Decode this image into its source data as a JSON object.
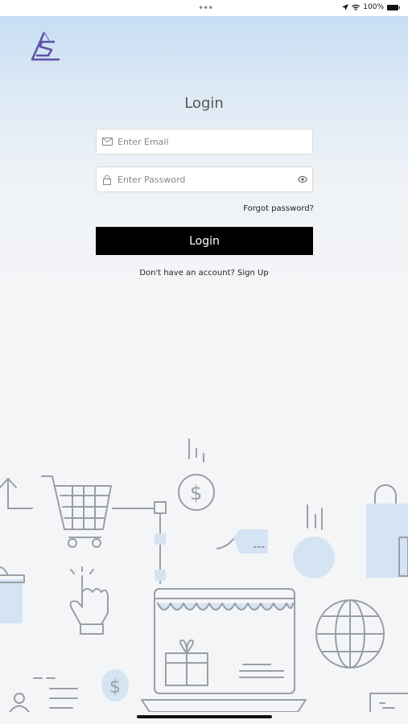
{
  "status_bar": {
    "dots": "•••",
    "battery": "100%"
  },
  "login": {
    "title": "Login",
    "email_placeholder": "Enter Email",
    "password_placeholder": "Enter Password",
    "forgot": "Forgot password?",
    "button": "Login",
    "signup_prompt": "Don't have an account?",
    "signup_link": "Sign Up"
  },
  "icons": [
    "mail-icon",
    "lock-icon",
    "eye-icon",
    "location-arrow-icon",
    "wifi-icon",
    "battery-icon"
  ],
  "colors": {
    "accent_purple": "#5c4fa8",
    "button_bg": "#000000",
    "illustration_line": "#9a9ea5",
    "illustration_fill": "#d5e4f3"
  }
}
